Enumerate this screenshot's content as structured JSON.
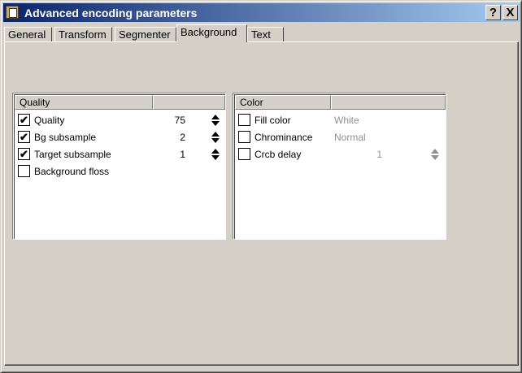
{
  "window": {
    "title": "Advanced encoding parameters",
    "help_label": "?",
    "close_label": "X"
  },
  "tabs": [
    {
      "label": "General"
    },
    {
      "label": "Transform"
    },
    {
      "label": "Segmenter"
    },
    {
      "label": "Background",
      "active": true
    },
    {
      "label": "Text"
    }
  ],
  "quality_panel": {
    "header": "Quality",
    "rows": [
      {
        "label": "Quality",
        "checked": true,
        "value": "75"
      },
      {
        "label": "Bg subsample",
        "checked": true,
        "value": "2"
      },
      {
        "label": "Target subsample",
        "checked": true,
        "value": "1"
      },
      {
        "label": "Background floss",
        "checked": false
      }
    ]
  },
  "color_panel": {
    "header": "Color",
    "rows": [
      {
        "label": "Fill color",
        "checked": false,
        "value": "White"
      },
      {
        "label": "Chrominance",
        "checked": false,
        "value": "Normal"
      },
      {
        "label": "Crcb delay",
        "checked": false,
        "value": "1"
      }
    ]
  },
  "check_glyph": "✔",
  "colors": {
    "title_start": "#0a246a",
    "title_end": "#a6caf0",
    "face": "#d4d0c8",
    "disabled_text": "#909090"
  }
}
